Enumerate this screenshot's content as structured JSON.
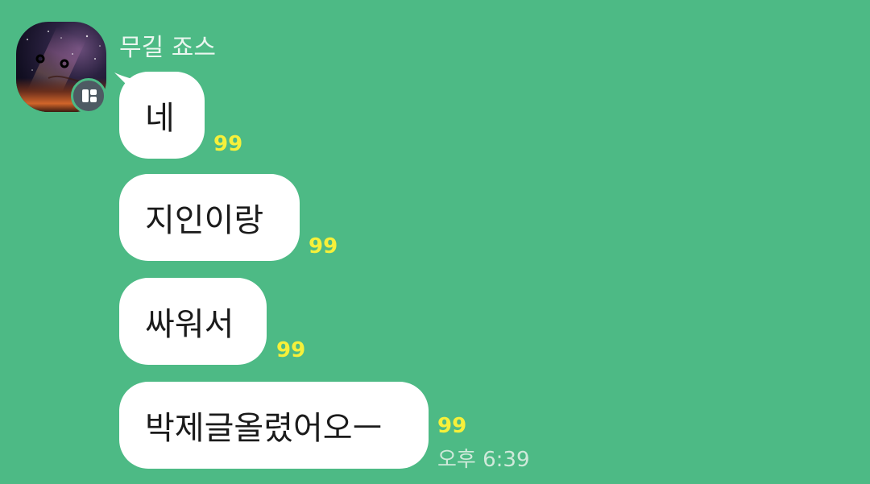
{
  "chat": {
    "background_color": "#4dba85",
    "sender": {
      "name": "무길 죠스",
      "avatar_icon": "profile-photo-night-sky",
      "badge_icon": "plus-friend-icon"
    },
    "messages": [
      {
        "text": "네",
        "unread": "99"
      },
      {
        "text": "지인이랑",
        "unread": "99"
      },
      {
        "text": "싸워서",
        "unread": "99"
      },
      {
        "text": "박제글올렸어오ㅡ",
        "unread": "99",
        "time": "오후 6:39"
      }
    ]
  },
  "colors": {
    "bubble": "#ffffff",
    "unread_count": "#f6f03a",
    "name_text": "#eaf6ef",
    "time_text": "#cfe9da"
  }
}
